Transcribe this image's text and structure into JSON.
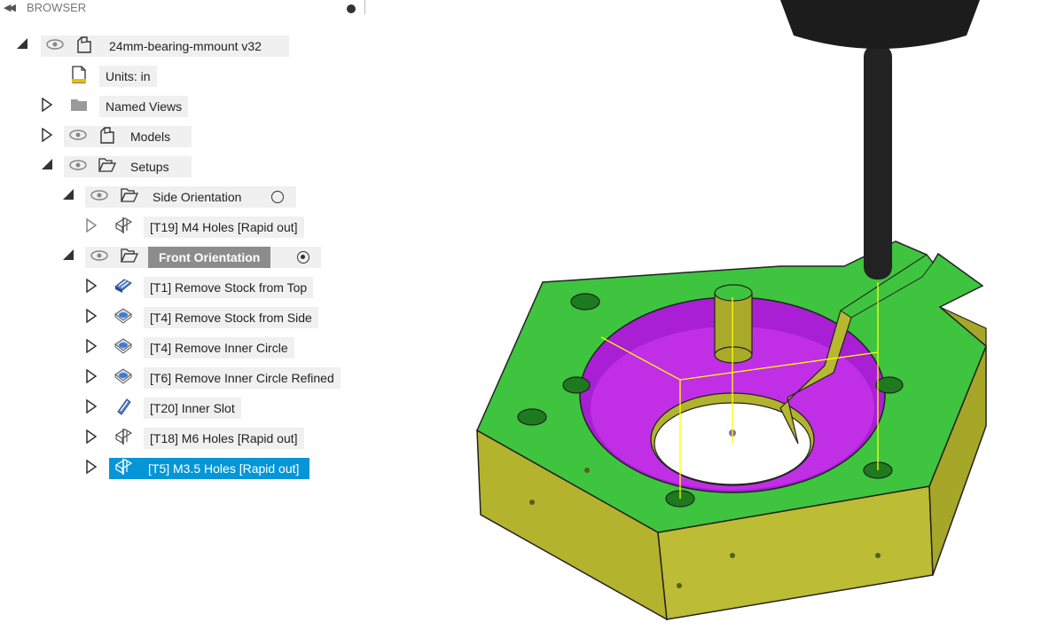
{
  "browser": {
    "title": "BROWSER",
    "collapse_icon": "double-left-arrow-icon",
    "tree": {
      "root": "24mm-bearing-mmount v32",
      "units": "Units: in",
      "named_views": "Named Views",
      "models": "Models",
      "setups": "Setups",
      "side_orientation": "Side Orientation",
      "side_ops": [
        "[T19] M4 Holes [Rapid out]"
      ],
      "front_orientation": "Front Orientation",
      "front_ops": [
        "[T1] Remove Stock from Top",
        "[T4] Remove Stock from Side",
        "[T4] Remove Inner Circle",
        "[T6] Remove Inner Circle Refined",
        "[T20] Inner Slot",
        "[T18] M6 Holes [Rapid out]",
        "[T5] M3.5 Holes [Rapid out]"
      ],
      "selected_item": "[T5] M3.5 Holes [Rapid out]"
    }
  },
  "colors": {
    "selection": "#0696d7",
    "active_setup": "#8c8c8c",
    "part_top": "#39c439",
    "part_side": "#b5b532",
    "pocket": "#a020d0",
    "toolpath": "#ffff00",
    "tool": "#222222"
  },
  "viewport": {
    "content": "3D CAM view of hexagonal bearing mount with milling tool"
  }
}
